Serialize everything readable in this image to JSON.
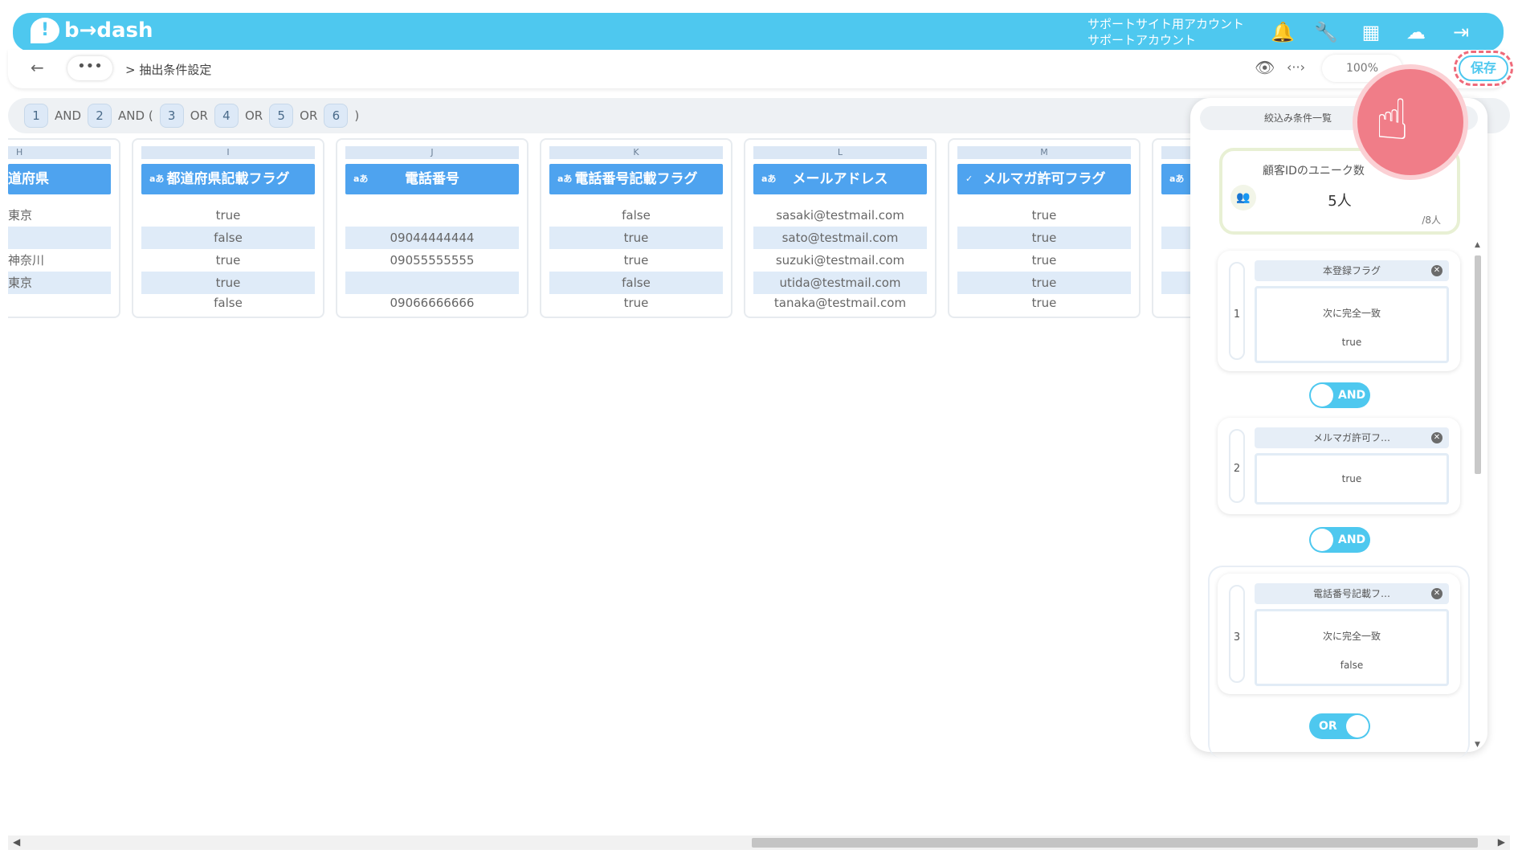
{
  "header": {
    "logo_text": "b→dash",
    "account_line1": "サポートサイト用アカウント",
    "account_line2": "サポートアカウント",
    "icons": [
      "bell-icon",
      "wrench-icon",
      "grid-icon",
      "chat-icon",
      "logout-icon"
    ]
  },
  "subbar": {
    "back_symbol": "←",
    "dots": "•••",
    "breadcrumb": "> 抽出条件設定",
    "zoom": "100%",
    "save_label": "保存"
  },
  "formula": {
    "tokens": [
      {
        "type": "chip",
        "text": "1"
      },
      {
        "type": "op",
        "text": "AND"
      },
      {
        "type": "chip",
        "text": "2"
      },
      {
        "type": "op",
        "text": "AND ("
      },
      {
        "type": "chip",
        "text": "3"
      },
      {
        "type": "op",
        "text": "OR"
      },
      {
        "type": "chip",
        "text": "4"
      },
      {
        "type": "op",
        "text": "OR"
      },
      {
        "type": "chip",
        "text": "5"
      },
      {
        "type": "op",
        "text": "OR"
      },
      {
        "type": "chip",
        "text": "6"
      },
      {
        "type": "op",
        "text": ")"
      }
    ]
  },
  "table": {
    "columns": [
      {
        "letter": "H",
        "header": "道府県",
        "type": "",
        "cells": [
          "東京",
          "",
          "神奈川",
          "東京",
          ""
        ]
      },
      {
        "letter": "I",
        "header": "都道府県記載フラグ",
        "type": "aあ",
        "cells": [
          "true",
          "false",
          "true",
          "true",
          "false"
        ]
      },
      {
        "letter": "J",
        "header": "電話番号",
        "type": "aあ",
        "cells": [
          "",
          "09044444444",
          "09055555555",
          "",
          "09066666666"
        ]
      },
      {
        "letter": "K",
        "header": "電話番号記載フラグ",
        "type": "aあ",
        "cells": [
          "false",
          "true",
          "true",
          "false",
          "true"
        ]
      },
      {
        "letter": "L",
        "header": "メールアドレス",
        "type": "aあ",
        "cells": [
          "sasaki@testmail.com",
          "sato@testmail.com",
          "suzuki@testmail.com",
          "utida@testmail.com",
          "tanaka@testmail.com"
        ]
      },
      {
        "letter": "M",
        "header": "メルマガ許可フラグ",
        "type": "✓",
        "cells": [
          "true",
          "true",
          "true",
          "true",
          "true"
        ]
      },
      {
        "letter": "",
        "header": "",
        "type": "aあ",
        "cells": [
          "",
          "",
          "",
          "",
          ""
        ]
      }
    ]
  },
  "panel": {
    "tab_label": "絞込み条件一覧",
    "unique_title": "顧客IDのユニーク数",
    "unique_value": "5人",
    "unique_total": "/8人",
    "conditions": [
      {
        "num": "1",
        "field": "本登録フラグ",
        "line1": "次に完全一致",
        "line2": "true"
      },
      {
        "num": "2",
        "field": "メルマガ許可フ…",
        "line1": "true",
        "line2": ""
      },
      {
        "num": "3",
        "field": "電話番号記載フ…",
        "line1": "次に完全一致",
        "line2": "false"
      }
    ],
    "toggles": [
      "AND",
      "AND",
      "OR"
    ]
  }
}
